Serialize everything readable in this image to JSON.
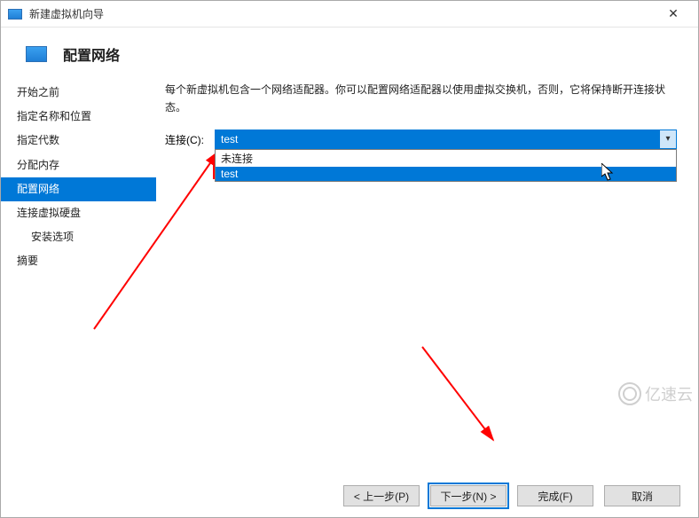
{
  "window": {
    "title": "新建虚拟机向导"
  },
  "header": {
    "title": "配置网络"
  },
  "sidebar": {
    "items": [
      {
        "label": "开始之前",
        "active": false,
        "sub": false
      },
      {
        "label": "指定名称和位置",
        "active": false,
        "sub": false
      },
      {
        "label": "指定代数",
        "active": false,
        "sub": false
      },
      {
        "label": "分配内存",
        "active": false,
        "sub": false
      },
      {
        "label": "配置网络",
        "active": true,
        "sub": false
      },
      {
        "label": "连接虚拟硬盘",
        "active": false,
        "sub": false
      },
      {
        "label": "安装选项",
        "active": false,
        "sub": true
      },
      {
        "label": "摘要",
        "active": false,
        "sub": false
      }
    ]
  },
  "main": {
    "description": "每个新虚拟机包含一个网络适配器。你可以配置网络适配器以使用虚拟交换机，否则，它将保持断开连接状态。",
    "connection_label": "连接(C):",
    "combo_selected": "test",
    "dropdown": {
      "options": [
        {
          "label": "未连接",
          "selected": false
        },
        {
          "label": "test",
          "selected": true
        }
      ]
    }
  },
  "footer": {
    "prev": "< 上一步(P)",
    "next": "下一步(N) >",
    "finish": "完成(F)",
    "cancel": "取消"
  },
  "watermark": "亿速云"
}
